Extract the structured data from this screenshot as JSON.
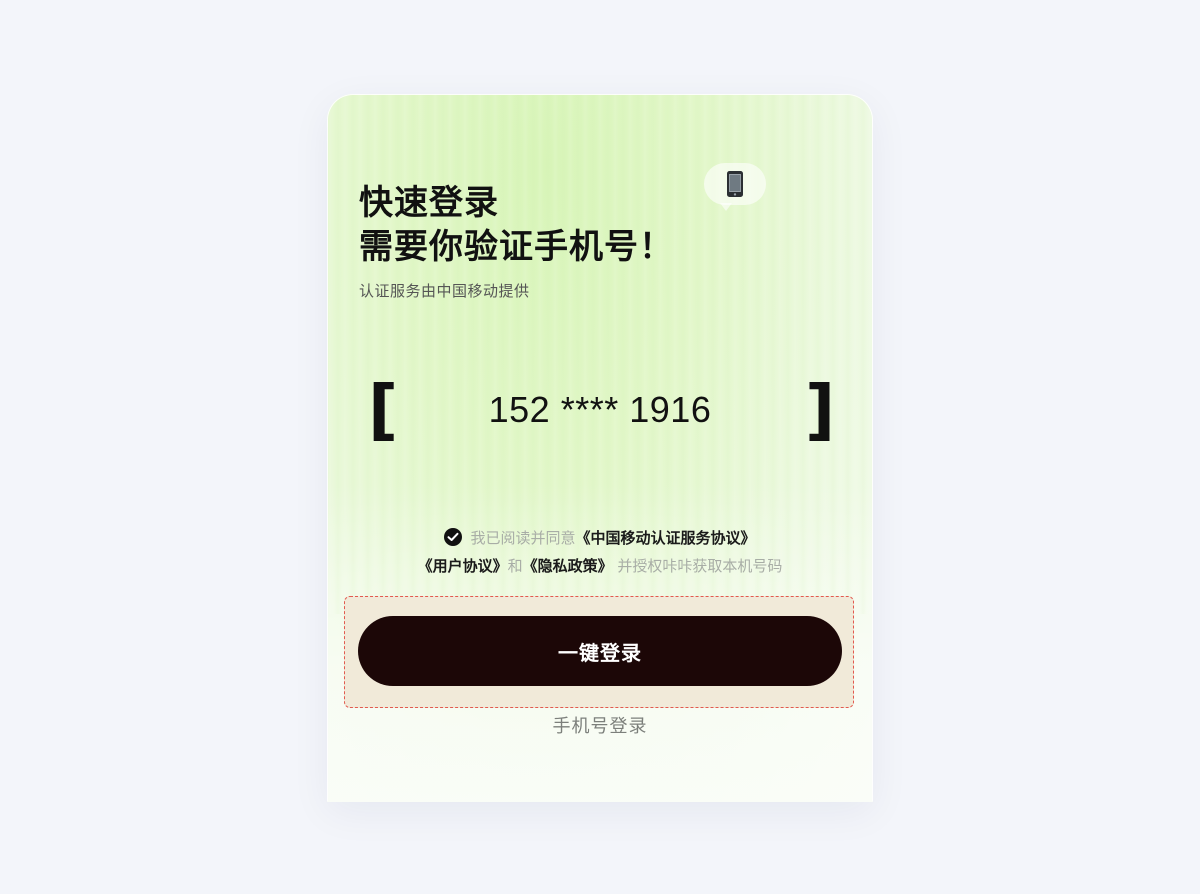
{
  "header": {
    "title_line1": "快速登录",
    "title_line2": "需要你验证手机号！",
    "subtitle": "认证服务由中国移动提供",
    "phone_icon": "mobile-phone-icon"
  },
  "phone": {
    "bracket_left": "[",
    "masked_number": "152 **** 1916",
    "bracket_right": "]"
  },
  "agreement": {
    "checked": true,
    "prefix": "我已阅读并同意",
    "cmcc_terms": "《中国移动认证服务协议》",
    "user_agreement": "《用户协议》",
    "and": "和",
    "privacy_policy": "《隐私政策》",
    "suffix": "并授权咔咔获取本机号码"
  },
  "actions": {
    "one_click_login": "一键登录",
    "phone_login": "手机号登录"
  },
  "colors": {
    "button_bg": "#1c0707",
    "card_gradient_top": "#d8f5b8",
    "highlight_frame": "#e25a4f"
  }
}
